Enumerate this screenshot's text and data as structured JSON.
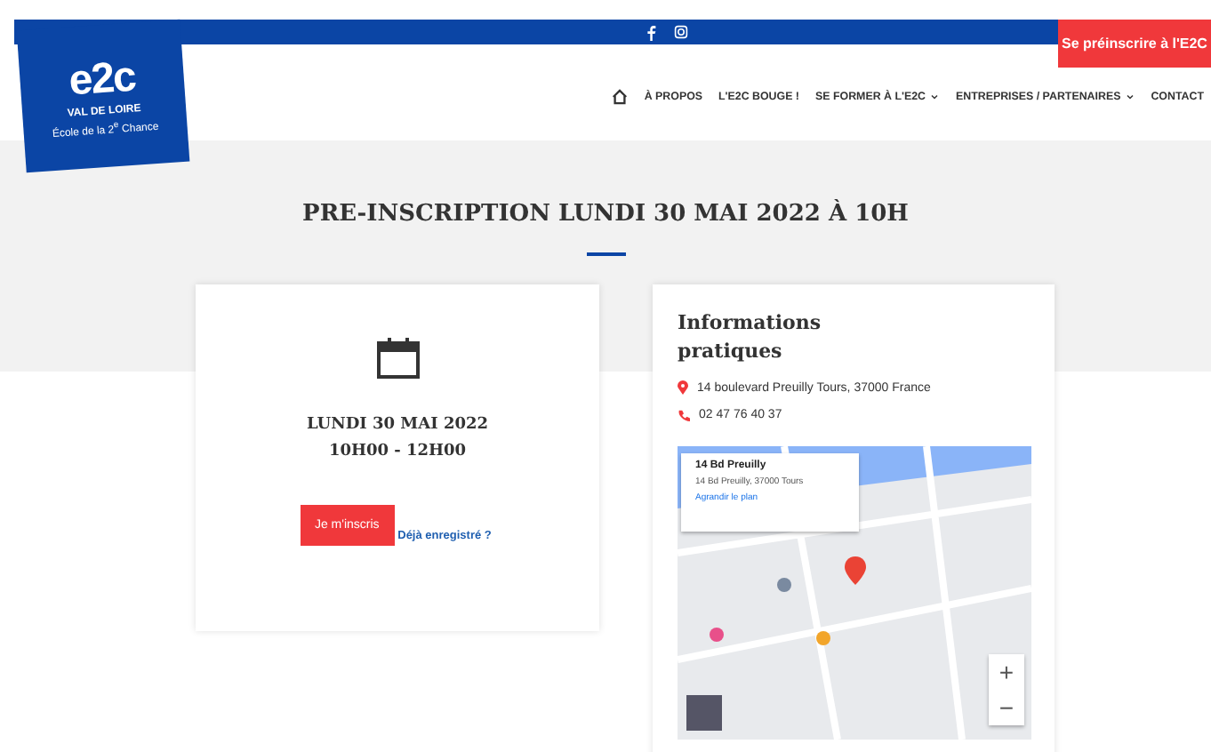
{
  "top_bar": {
    "register_button": "Se préinscrire à l'E2C"
  },
  "logo": {
    "letters": "e2c",
    "region": "VAL DE LOIRE",
    "subtitle": "École de la 2$^{e}$ Chance"
  },
  "nav": {
    "items": [
      {
        "label": "À PROPOS",
        "dropdown": false
      },
      {
        "label": "L'E2C BOUGE !",
        "dropdown": false
      },
      {
        "label": "SE FORMER À L'E2C",
        "dropdown": true
      },
      {
        "label": "ENTREPRISES / PARTENAIRES",
        "dropdown": true
      },
      {
        "label": "CONTACT",
        "dropdown": false
      }
    ]
  },
  "page_title": "PRE-INSCRIPTION LUNDI 30 MAI 2022 À 10H",
  "event_card": {
    "date": "LUNDI 30 MAI 2022",
    "time": "10H00 - 12H00",
    "register_button": "Je m'inscris",
    "already_link": "Déjà enregistré ?"
  },
  "info_card": {
    "title": "Informations pratiques",
    "address": "14 boulevard Preuilly Tours, 37000 France",
    "phone": "02 47 76 40 37",
    "map": {
      "place_name": "14 Bd Preuilly",
      "place_address": "14 Bd Preuilly, 37000 Tours",
      "enlarge_link": "Agrandir le plan",
      "zoom_in": "+",
      "zoom_out": "−"
    }
  }
}
